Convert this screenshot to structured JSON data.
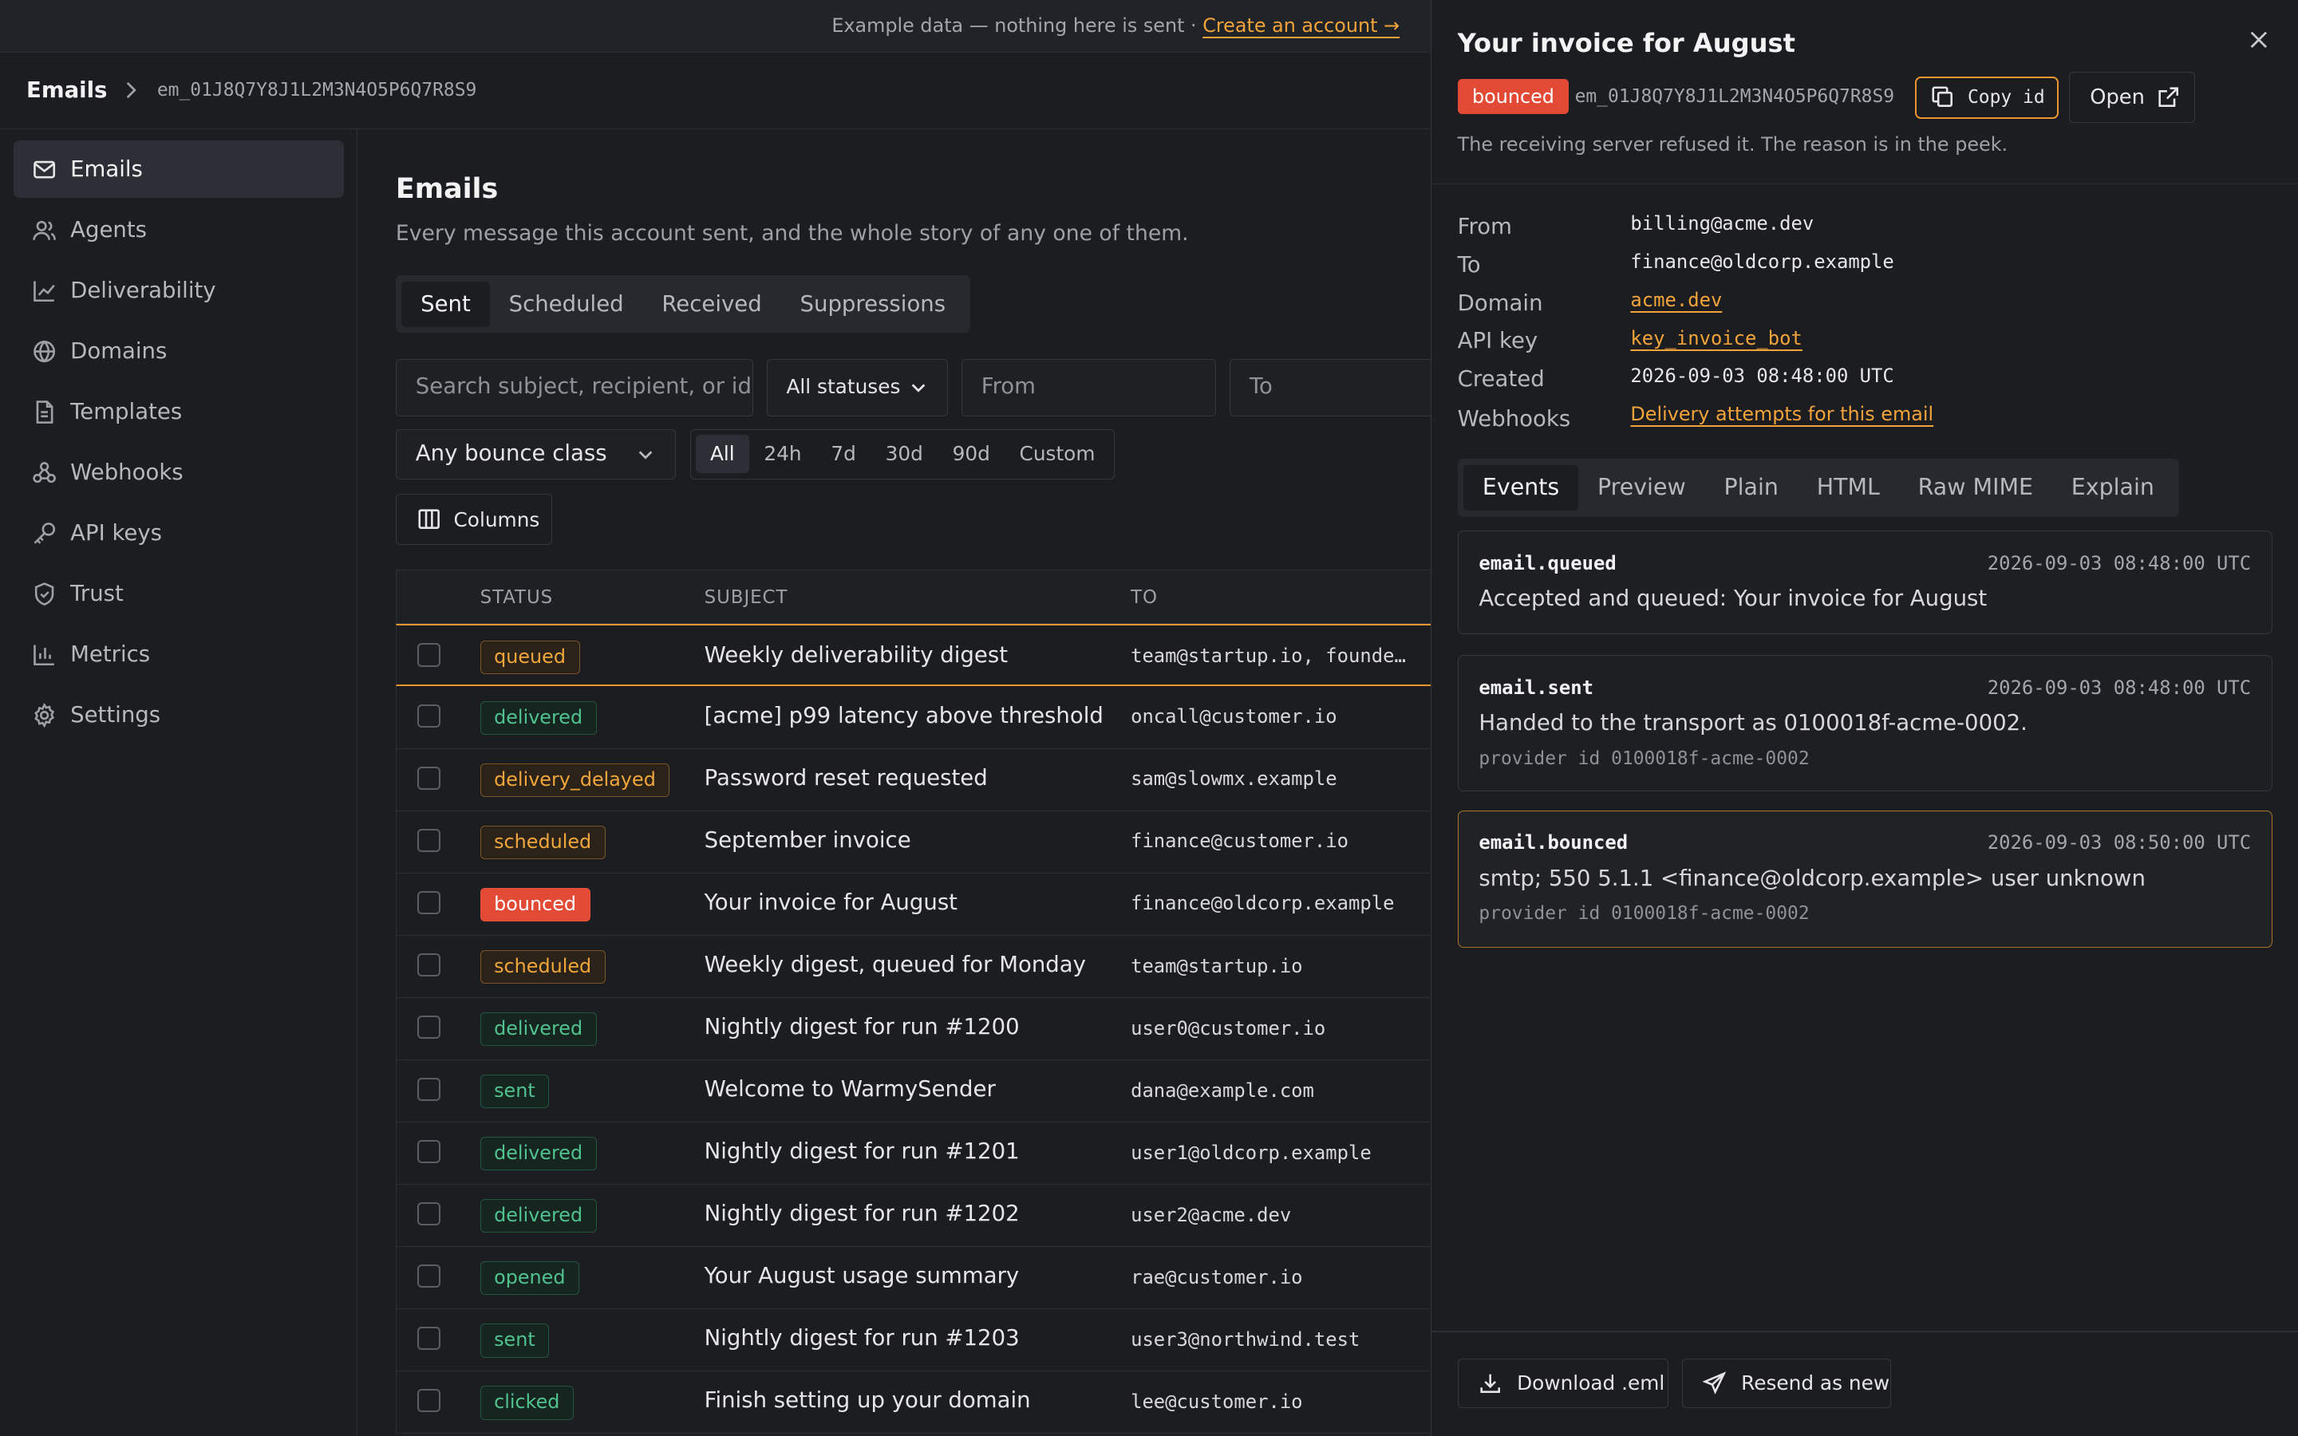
{
  "banner": {
    "text": "Example data — nothing here is sent ·",
    "link": "Create an account →"
  },
  "breadcrumb": {
    "root": "Emails",
    "id": "em_01J8Q7Y8J1L2M3N4O5P6Q7R8S9"
  },
  "sidebar": {
    "items": [
      {
        "label": "Emails",
        "icon": "mail-icon",
        "active": true
      },
      {
        "label": "Agents",
        "icon": "users-icon"
      },
      {
        "label": "Deliverability",
        "icon": "line-chart-icon"
      },
      {
        "label": "Domains",
        "icon": "globe-icon"
      },
      {
        "label": "Templates",
        "icon": "file-icon"
      },
      {
        "label": "Webhooks",
        "icon": "webhook-icon"
      },
      {
        "label": "API keys",
        "icon": "key-icon"
      },
      {
        "label": "Trust",
        "icon": "shield-icon"
      },
      {
        "label": "Metrics",
        "icon": "bar-chart-icon"
      },
      {
        "label": "Settings",
        "icon": "gear-icon"
      }
    ]
  },
  "main": {
    "title": "Emails",
    "subtitle": "Every message this account sent, and the whole story of any one of them.",
    "tabs": [
      "Sent",
      "Scheduled",
      "Received",
      "Suppressions"
    ],
    "search_placeholder": "Search subject, recipient, or id",
    "status_select": "All statuses",
    "from_placeholder": "From",
    "to_placeholder": "To",
    "bounce_select": "Any bounce class",
    "ranges": [
      "All",
      "24h",
      "7d",
      "30d",
      "90d",
      "Custom"
    ],
    "columns_button": "Columns",
    "table": {
      "headers": [
        "STATUS",
        "SUBJECT",
        "TO"
      ],
      "rows": [
        {
          "status": "queued",
          "tone": "amber",
          "subject": "Weekly deliverability digest",
          "to": "team@startup.io, founde…",
          "selected": true
        },
        {
          "status": "delivered",
          "tone": "green",
          "subject": "[acme] p99 latency above threshold",
          "to": "oncall@customer.io"
        },
        {
          "status": "delivery_delayed",
          "tone": "amber",
          "subject": "Password reset requested",
          "to": "sam@slowmx.example"
        },
        {
          "status": "scheduled",
          "tone": "amber",
          "subject": "September invoice",
          "to": "finance@customer.io"
        },
        {
          "status": "bounced",
          "tone": "red",
          "subject": "Your invoice for August",
          "to": "finance@oldcorp.example"
        },
        {
          "status": "scheduled",
          "tone": "amber",
          "subject": "Weekly digest, queued for Monday",
          "to": "team@startup.io"
        },
        {
          "status": "delivered",
          "tone": "green",
          "subject": "Nightly digest for run #1200",
          "to": "user0@customer.io"
        },
        {
          "status": "sent",
          "tone": "green",
          "subject": "Welcome to WarmySender",
          "to": "dana@example.com"
        },
        {
          "status": "delivered",
          "tone": "green",
          "subject": "Nightly digest for run #1201",
          "to": "user1@oldcorp.example"
        },
        {
          "status": "delivered",
          "tone": "green",
          "subject": "Nightly digest for run #1202",
          "to": "user2@acme.dev"
        },
        {
          "status": "opened",
          "tone": "green",
          "subject": "Your August usage summary",
          "to": "rae@customer.io"
        },
        {
          "status": "sent",
          "tone": "green",
          "subject": "Nightly digest for run #1203",
          "to": "user3@northwind.test"
        },
        {
          "status": "clicked",
          "tone": "green",
          "subject": "Finish setting up your domain",
          "to": "lee@customer.io"
        }
      ]
    }
  },
  "panel": {
    "title": "Your invoice for August",
    "status": "bounced",
    "id": "em_01J8Q7Y8J1L2M3N4O5P6Q7R8S9",
    "copy_label": "Copy id",
    "open_label": "Open",
    "description": "The receiving server refused it. The reason is in the peek.",
    "details": {
      "from_label": "From",
      "from": "billing@acme.dev",
      "to_label": "To",
      "to": "finance@oldcorp.example",
      "domain_label": "Domain",
      "domain": "acme.dev",
      "apikey_label": "API key",
      "apikey": "key_invoice_bot",
      "created_label": "Created",
      "created": "2026-09-03 08:48:00 UTC",
      "webhooks_label": "Webhooks",
      "webhooks": "Delivery attempts for this email"
    },
    "tabs": [
      "Events",
      "Preview",
      "Plain",
      "HTML",
      "Raw MIME",
      "Explain"
    ],
    "events": [
      {
        "name": "email.queued",
        "time": "2026-09-03 08:48:00 UTC",
        "message": "Accepted and queued: Your invoice for August"
      },
      {
        "name": "email.sent",
        "time": "2026-09-03 08:48:00 UTC",
        "message": "Handed to the transport as 0100018f-acme-0002.",
        "provider": "provider id 0100018f-acme-0002"
      },
      {
        "name": "email.bounced",
        "time": "2026-09-03 08:50:00 UTC",
        "message": "smtp; 550 5.1.1 <finance@oldcorp.example> user unknown",
        "provider": "provider id 0100018f-acme-0002"
      }
    ],
    "download_label": "Download .eml",
    "resend_label": "Resend as new"
  }
}
